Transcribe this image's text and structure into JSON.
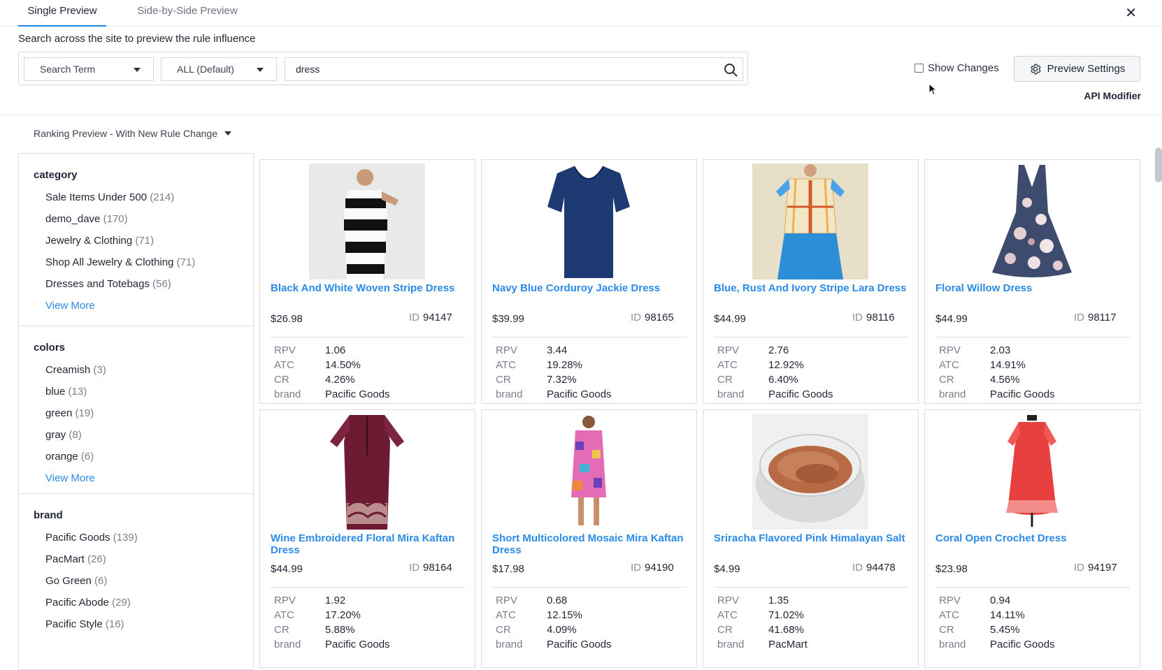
{
  "tabs": [
    {
      "label": "Single Preview",
      "active": true
    },
    {
      "label": "Side-by-Side Preview",
      "active": false
    }
  ],
  "instruction": "Search across the site to preview the rule influence",
  "search": {
    "type_select": "Search Term",
    "scope_select": "ALL (Default)",
    "query": "dress"
  },
  "show_changes_label": "Show Changes",
  "preview_settings_label": "Preview Settings",
  "api_modifier_label": "API Modifier",
  "ranking_select": "Ranking Preview - With New Rule Change",
  "facets": {
    "category": {
      "title": "category",
      "items": [
        {
          "label": "Sale Items Under 500",
          "count": "(214)"
        },
        {
          "label": "demo_dave",
          "count": "(170)"
        },
        {
          "label": "Jewelry & Clothing",
          "count": "(71)"
        },
        {
          "label": "Shop All Jewelry & Clothing",
          "count": "(71)"
        },
        {
          "label": "Dresses and Totebags",
          "count": "(56)"
        }
      ],
      "view_more": "View More"
    },
    "colors": {
      "title": "colors",
      "items": [
        {
          "label": "Creamish",
          "count": "(3)"
        },
        {
          "label": "blue",
          "count": "(13)"
        },
        {
          "label": "green",
          "count": "(19)"
        },
        {
          "label": "gray",
          "count": "(8)"
        },
        {
          "label": "orange",
          "count": "(6)"
        }
      ],
      "view_more": "View More"
    },
    "brand": {
      "title": "brand",
      "items": [
        {
          "label": "Pacific Goods",
          "count": "(139)"
        },
        {
          "label": "PacMart",
          "count": "(26)"
        },
        {
          "label": "Go Green",
          "count": "(6)"
        },
        {
          "label": "Pacific Abode",
          "count": "(29)"
        },
        {
          "label": "Pacific Style",
          "count": "(16)"
        }
      ]
    }
  },
  "metric_labels": {
    "rpv": "RPV",
    "atc": "ATC",
    "cr": "CR",
    "brand": "brand"
  },
  "id_label": "ID",
  "products": [
    {
      "name": "Black And White Woven Stripe Dress",
      "price": "$26.98",
      "id": "94147",
      "rpv": "1.06",
      "atc": "14.50%",
      "cr": "4.26%",
      "brand": "Pacific Goods",
      "icon": "striped-dress-image"
    },
    {
      "name": "Navy Blue Corduroy Jackie Dress",
      "price": "$39.99",
      "id": "98165",
      "rpv": "3.44",
      "atc": "19.28%",
      "cr": "7.32%",
      "brand": "Pacific Goods",
      "icon": "navy-dress-image"
    },
    {
      "name": "Blue, Rust And Ivory Stripe Lara Dress",
      "price": "$44.99",
      "id": "98116",
      "rpv": "2.76",
      "atc": "12.92%",
      "cr": "6.40%",
      "brand": "Pacific Goods",
      "icon": "lara-dress-image"
    },
    {
      "name": "Floral Willow Dress",
      "price": "$44.99",
      "id": "98117",
      "rpv": "2.03",
      "atc": "14.91%",
      "cr": "4.56%",
      "brand": "Pacific Goods",
      "icon": "floral-dress-image"
    },
    {
      "name": "Wine Embroidered Floral Mira Kaftan Dress",
      "price": "$44.99",
      "id": "98164",
      "rpv": "1.92",
      "atc": "17.20%",
      "cr": "5.88%",
      "brand": "Pacific Goods",
      "icon": "wine-kaftan-image"
    },
    {
      "name": "Short Multicolored Mosaic Mira Kaftan Dress",
      "price": "$17.98",
      "id": "94190",
      "rpv": "0.68",
      "atc": "12.15%",
      "cr": "4.09%",
      "brand": "Pacific Goods",
      "icon": "mosaic-kaftan-image"
    },
    {
      "name": "Sriracha Flavored Pink Himalayan Salt",
      "price": "$4.99",
      "id": "94478",
      "rpv": "1.35",
      "atc": "71.02%",
      "cr": "41.68%",
      "brand": "PacMart",
      "icon": "salt-jar-image"
    },
    {
      "name": "Coral Open Crochet Dress",
      "price": "$23.98",
      "id": "94197",
      "rpv": "0.94",
      "atc": "14.11%",
      "cr": "5.45%",
      "brand": "Pacific Goods",
      "icon": "coral-dress-image"
    }
  ],
  "colors": {
    "accent": "#1e88e5",
    "link": "#2b8be6",
    "border": "#d9dce0",
    "muted": "#7a808c"
  }
}
